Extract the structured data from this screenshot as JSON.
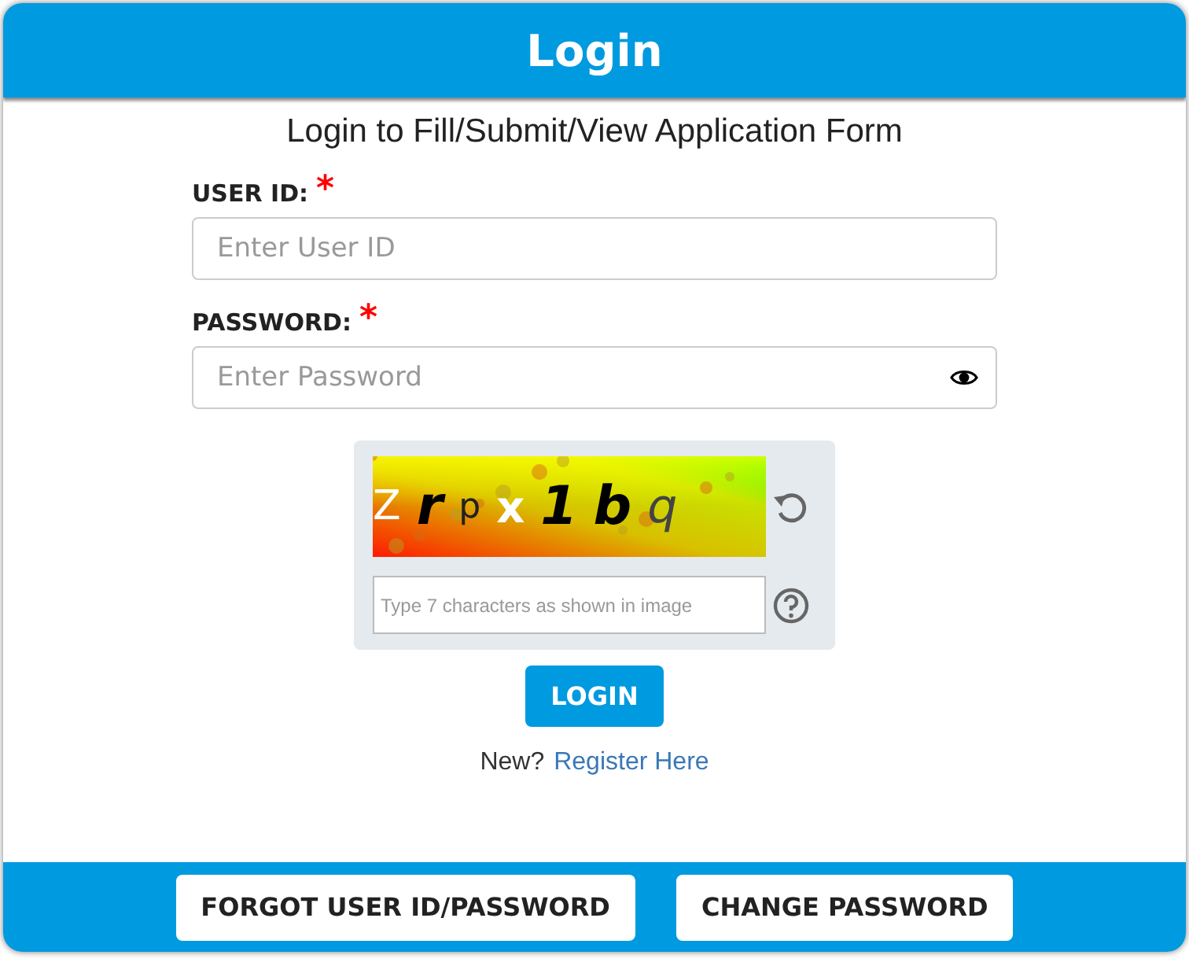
{
  "header": {
    "title": "Login"
  },
  "subtitle": "Login to Fill/Submit/View Application Form",
  "fields": [
    {
      "label": "USER ID:",
      "required_mark": "*",
      "placeholder": "Enter User ID",
      "kind": "text"
    },
    {
      "label": "PASSWORD:",
      "required_mark": "*",
      "placeholder": "Enter Password",
      "kind": "password"
    }
  ],
  "captcha": {
    "chars": [
      {
        "char": "Z",
        "kind": "light"
      },
      {
        "char": "r",
        "kind": "heavy"
      },
      {
        "char": "p",
        "kind": "thin"
      },
      {
        "char": "x",
        "kind": "pale-bold"
      },
      {
        "char": "1",
        "kind": "heavy"
      },
      {
        "char": "b",
        "kind": "heavy"
      },
      {
        "char": "q",
        "kind": "slant"
      }
    ],
    "placeholder": "Type 7 characters as shown in image"
  },
  "login_button": "LOGIN",
  "register": {
    "prompt": "New?",
    "link": "Register Here"
  },
  "footer_buttons": [
    "FORGOT USER ID/PASSWORD",
    "CHANGE PASSWORD"
  ]
}
